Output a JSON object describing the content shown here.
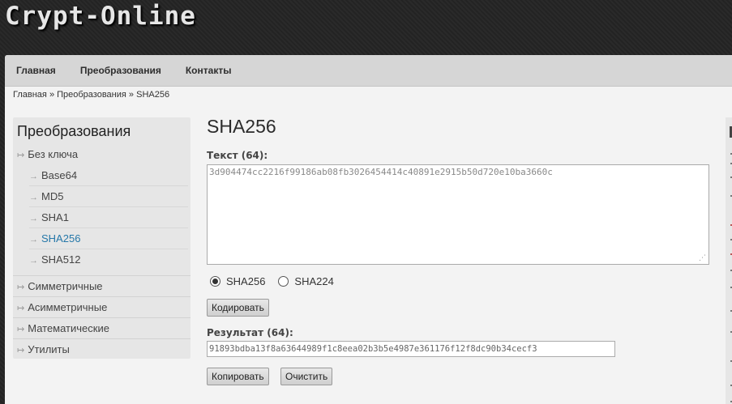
{
  "logo": "Crypt-Online",
  "nav": [
    "Главная",
    "Преобразования",
    "Контакты"
  ],
  "breadcrumb": {
    "items": [
      "Главная",
      "Преобразования",
      "SHA256"
    ],
    "sep": "»"
  },
  "sidebar": {
    "title": "Преобразования",
    "groups": [
      {
        "label": "Без ключа",
        "children": [
          "Base64",
          "MD5",
          "SHA1",
          "SHA256",
          "SHA512"
        ],
        "active": "SHA256"
      },
      {
        "label": "Симметричные"
      },
      {
        "label": "Асимметричные"
      },
      {
        "label": "Математические"
      },
      {
        "label": "Утилиты"
      }
    ]
  },
  "main": {
    "title": "SHA256",
    "text_label": "Текст (64):",
    "text_value": "3d904474cc2216f99186ab08fb3026454414c40891e2915b50d720e10ba3660c",
    "radios": [
      {
        "label": "SHA256",
        "checked": true
      },
      {
        "label": "SHA224",
        "checked": false
      }
    ],
    "encode_button": "Кодировать",
    "result_label": "Результат (64):",
    "result_value": "91893bdba13f8a63644989f1c8eea02b3b5e4987e361176f12f8dc90b34cecf3",
    "copy_button": "Копировать",
    "clear_button": "Очистить"
  }
}
